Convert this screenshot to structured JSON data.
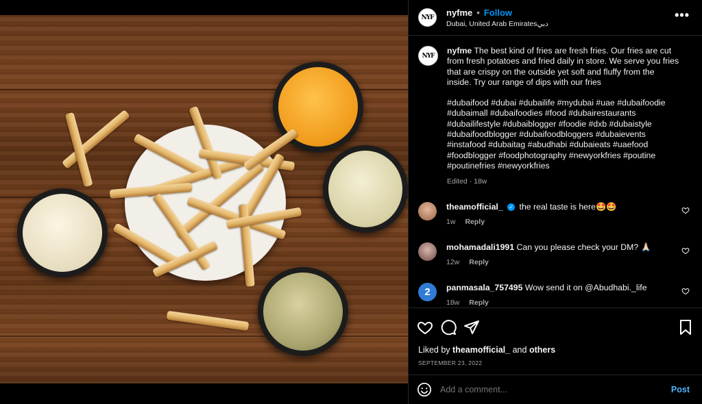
{
  "post": {
    "username": "nyfme",
    "avatar_text": "NYF",
    "follow_label": "Follow",
    "location": "Dubai, United Arab Emiratesدبي",
    "more_label": "•••"
  },
  "caption": {
    "username": "nyfme",
    "text": "The best kind of fries are fresh fries. Our fries are cut from fresh potatoes and fried daily in store. We serve you fries that are crispy on the outside yet soft and fluffy from the inside. Try our range of dips with our fries",
    "hashtags": "#dubaifood #dubai #dubailife #mydubai #uae #dubaifoodie #dubaimall #dubaifoodies #food #dubairestaurants #dubailifestyle #dubaiblogger #foodie #dxb #dubaistyle #dubaifoodblogger #dubaifoodbloggers #dubaievents #instafood #dubaitag #abudhabi #dubaieats #uaefood #foodblogger #foodphotography #newyorkfries #poutine #poutinefries #newyorkfries",
    "edited": "Edited · 18w"
  },
  "comments": [
    {
      "username": "theamofficial_",
      "verified": true,
      "text": "the real taste is here🤩🤩",
      "time": "1w",
      "reply": "Reply",
      "avatar_color": "#b07a5a"
    },
    {
      "username": "mohamadali1991",
      "verified": false,
      "text": "Can you please check your DM? 🙏🏻",
      "time": "12w",
      "reply": "Reply",
      "avatar_color": "#8a6b63"
    },
    {
      "username": "panmasala_757495",
      "verified": false,
      "text": "Wow send it on @Abudhabi._life",
      "time": "18w",
      "reply": "Reply",
      "avatar_color": "#2f7bd6",
      "avatar_text": "2"
    }
  ],
  "likes": {
    "prefix": "Liked by",
    "user": "theamofficial_",
    "and": "and",
    "others": "others"
  },
  "date": "SEPTEMBER 23, 2022",
  "add_comment": {
    "placeholder": "Add a comment...",
    "post_label": "Post"
  },
  "colors": {
    "accent": "#0095f6",
    "post_button": "#4db5f9"
  }
}
